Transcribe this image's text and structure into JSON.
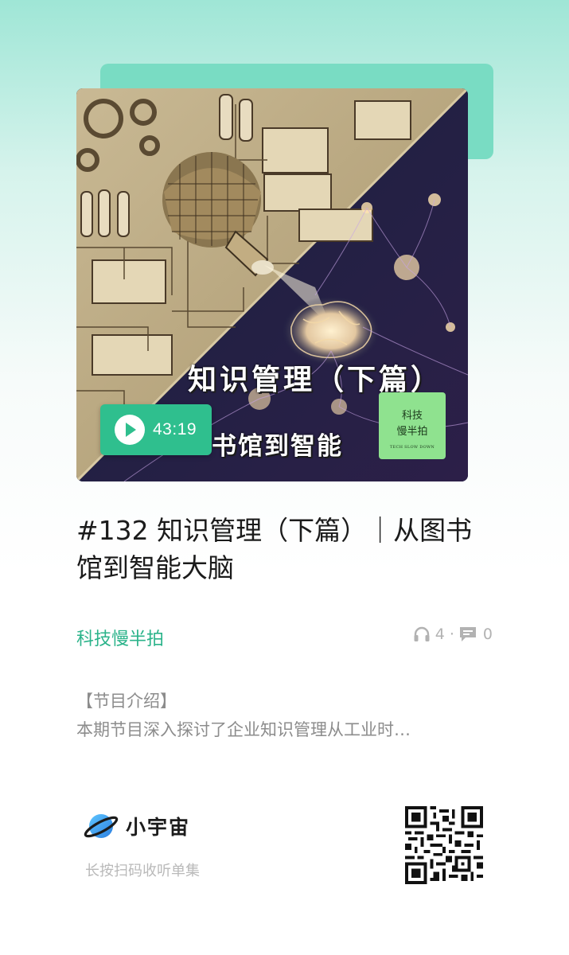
{
  "cover": {
    "duration": "43:19",
    "title_line1": "知识管理（下篇）",
    "title_line2": "书馆到智能",
    "badge_line1": "科技",
    "badge_line2": "慢半拍",
    "badge_subtitle": "TECH SLOW DOWN"
  },
  "episode": {
    "title": "#132 知识管理（下篇）｜从图书馆到智能大脑",
    "podcast_name": "科技慢半拍",
    "listens": "4",
    "separator": "·",
    "comments": "0"
  },
  "intro": {
    "heading": "【节目介绍】",
    "body": "本期节目深入探讨了企业知识管理从工业时…"
  },
  "footer": {
    "app_name": "小宇宙",
    "scan_hint": "长按扫码收听单集"
  },
  "colors": {
    "accent": "#2bb38a",
    "play_pill": "#2fbf8e",
    "card_back": "#79dcc3"
  },
  "icons": [
    "play-icon",
    "headphones-icon",
    "comment-icon",
    "planet-logo-icon",
    "qr-code"
  ]
}
